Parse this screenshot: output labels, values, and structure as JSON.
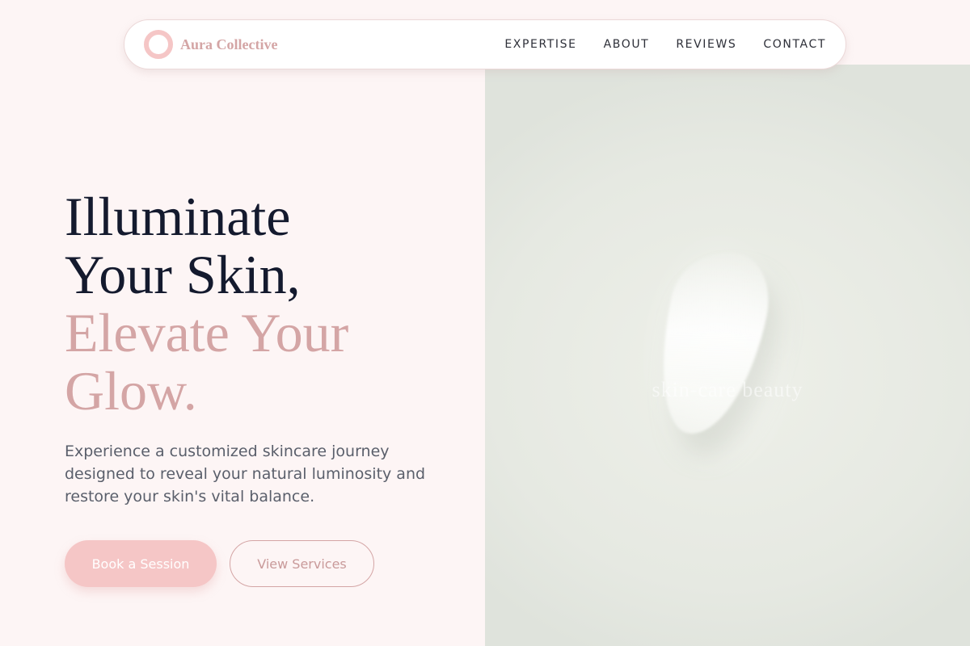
{
  "brand": {
    "name": "Aura Collective",
    "logo_icon": "ring-icon",
    "colors": {
      "primary": "#f5c6c6",
      "accent": "#d4a5a5",
      "dark": "#141a2e",
      "background": "#fdf5f5"
    }
  },
  "nav": {
    "links": [
      "EXPERTISE",
      "ABOUT",
      "REVIEWS",
      "CONTACT"
    ]
  },
  "hero": {
    "title_line1": "Illuminate",
    "title_line2": "Your Skin,",
    "title_line3": "Elevate Your",
    "title_line4": "Glow.",
    "description": "Experience a customized skincare journey designed to reveal your natural luminosity and restore your skin's vital balance.",
    "primary_button": "Book a Session",
    "secondary_button": "View Services",
    "image_caption": "skin-care beauty"
  }
}
